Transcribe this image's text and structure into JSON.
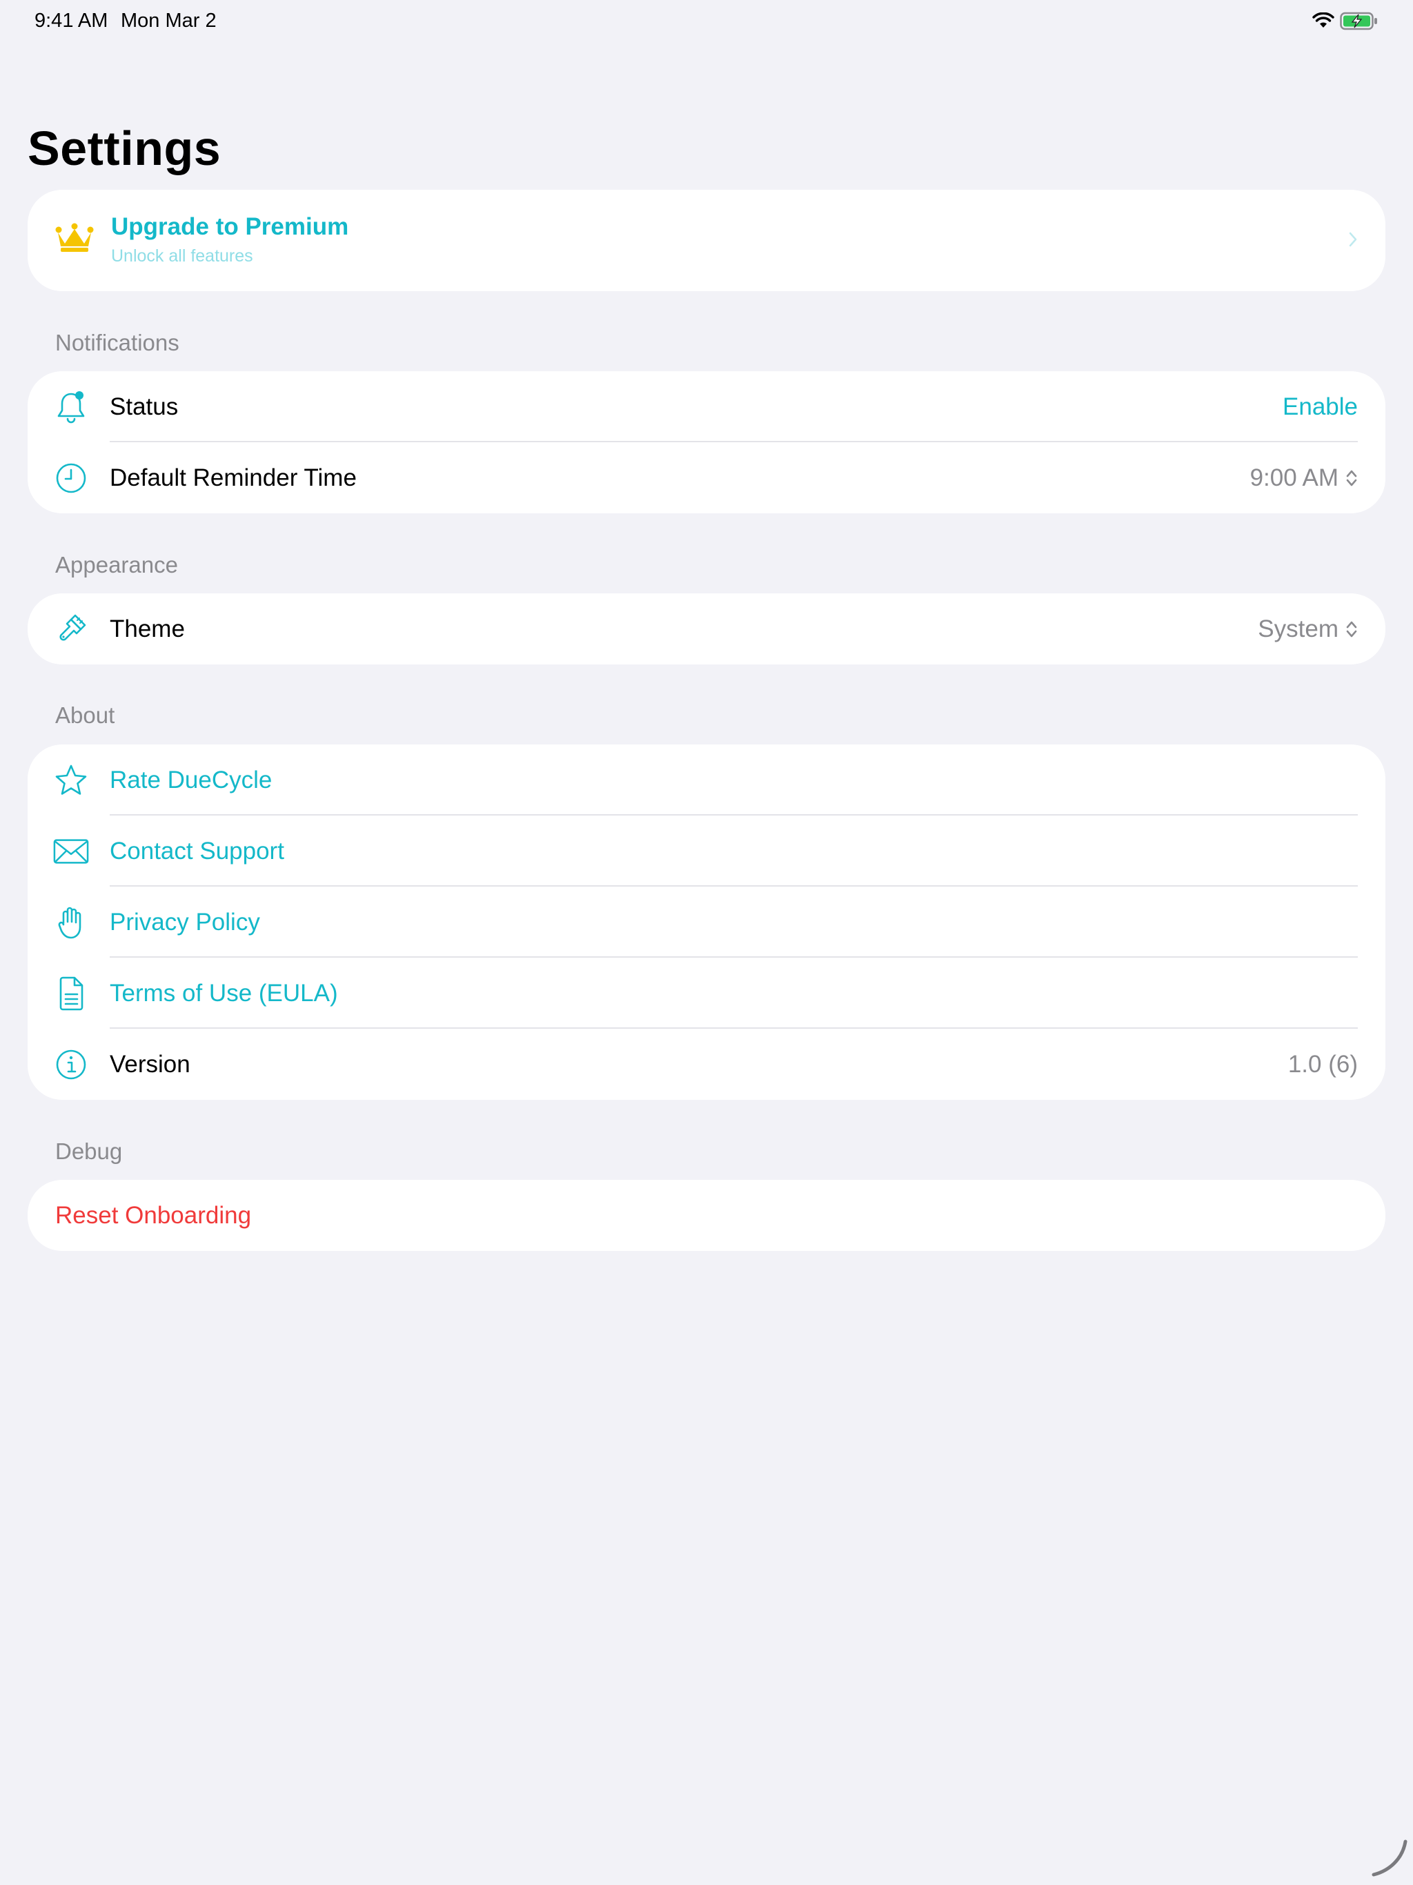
{
  "status_bar": {
    "time": "9:41 AM",
    "date": "Mon Mar 2"
  },
  "page": {
    "title": "Settings"
  },
  "premium": {
    "title": "Upgrade to Premium",
    "subtitle": "Unlock all features",
    "icon": "crown-icon"
  },
  "sections": {
    "notifications": {
      "header": "Notifications",
      "status": {
        "label": "Status",
        "value": "Enable",
        "icon": "bell-icon"
      },
      "reminder": {
        "label": "Default Reminder Time",
        "value": "9:00 AM",
        "icon": "clock-icon"
      }
    },
    "appearance": {
      "header": "Appearance",
      "theme": {
        "label": "Theme",
        "value": "System",
        "icon": "paintbrush-icon"
      }
    },
    "about": {
      "header": "About",
      "rate": {
        "label": "Rate DueCycle",
        "icon": "star-icon"
      },
      "contact": {
        "label": "Contact Support",
        "icon": "envelope-icon"
      },
      "privacy": {
        "label": "Privacy Policy",
        "icon": "hand-icon"
      },
      "terms": {
        "label": "Terms of Use (EULA)",
        "icon": "document-icon"
      },
      "version": {
        "label": "Version",
        "value": "1.0 (6)",
        "icon": "info-icon"
      }
    },
    "debug": {
      "header": "Debug",
      "reset": {
        "label": "Reset Onboarding"
      }
    }
  },
  "colors": {
    "accent": "#14b8c9",
    "destructive": "#f03a3a",
    "crown": "#f5c400",
    "background": "#f2f2f7",
    "secondary_text": "#8a8a8e"
  }
}
